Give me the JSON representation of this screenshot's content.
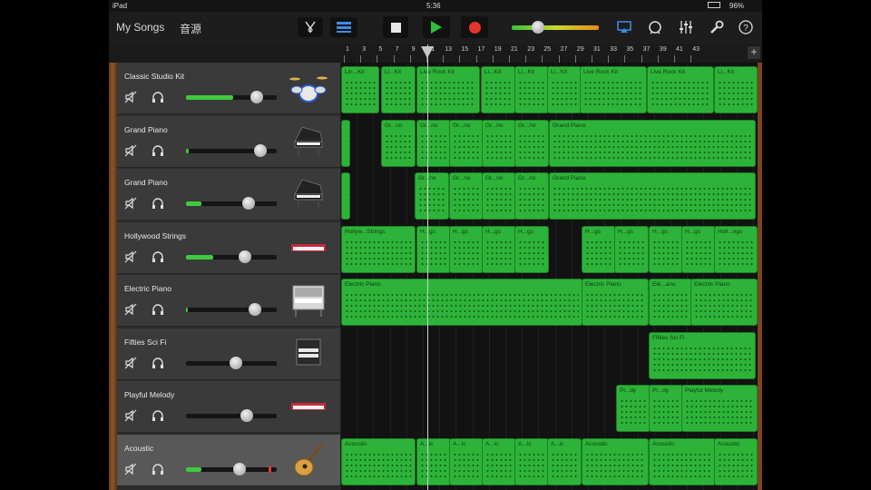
{
  "status_bar": {
    "device": "iPad",
    "time": "5:36",
    "battery": "96%"
  },
  "toolbar": {
    "my_songs": "My Songs",
    "browse": "音源",
    "volume_level": 0.3
  },
  "ruler": {
    "bars": [
      "1",
      "3",
      "5",
      "7",
      "9",
      "11",
      "13",
      "15",
      "17",
      "19",
      "21",
      "23",
      "25",
      "27",
      "29",
      "31",
      "33",
      "35",
      "37",
      "39",
      "41",
      "43"
    ]
  },
  "colors": {
    "region": "#2eb33a",
    "volume": "#3fca3f",
    "record": "#e5342c",
    "play": "#2fbf3a",
    "wood": "#8a5428"
  },
  "tracks": [
    {
      "name": "Classic Studio Kit",
      "instrument": "drum-kit",
      "volume": 0.78,
      "fill": 0.52,
      "regions": [
        {
          "label": "Lin...Kit"
        },
        {
          "label": "Li...Kit"
        },
        {
          "label": "Live Rock Kit"
        },
        {
          "label": "Li...Kit"
        },
        {
          "label": "Li...Kit"
        },
        {
          "label": "Li...Kit"
        },
        {
          "label": "Live Rock Kit"
        },
        {
          "label": "Live Rock Kit"
        },
        {
          "label": "Li...Kit"
        }
      ]
    },
    {
      "name": "Grand Piano",
      "instrument": "grand-piano",
      "volume": 0.82,
      "fill": 0.03,
      "regions": [
        {
          "label": ""
        },
        {
          "label": "Gr...no"
        },
        {
          "label": "Gr...no"
        },
        {
          "label": "Gr...no"
        },
        {
          "label": "Gr...no"
        },
        {
          "label": "Gr...no"
        },
        {
          "label": "Grand Piano"
        }
      ]
    },
    {
      "name": "Grand Piano",
      "instrument": "grand-piano",
      "volume": 0.69,
      "fill": 0.17,
      "regions": [
        {
          "label": ""
        },
        {
          "label": "Gr...no"
        },
        {
          "label": "Gr...no"
        },
        {
          "label": "Gr...no"
        },
        {
          "label": "Gr...no"
        },
        {
          "label": "Grand Piano"
        }
      ]
    },
    {
      "name": "Hollywood Strings",
      "instrument": "synth-keyboard",
      "volume": 0.65,
      "fill": 0.3,
      "regions": [
        {
          "label": "Hollyw...Strings"
        },
        {
          "label": "H...gs"
        },
        {
          "label": "H...gs"
        },
        {
          "label": "H...gs"
        },
        {
          "label": "H...gs"
        },
        {
          "label": "H...gs"
        },
        {
          "label": "H...gs"
        },
        {
          "label": "H...gs"
        },
        {
          "label": "H...gs"
        },
        {
          "label": "Holl...ngs"
        }
      ]
    },
    {
      "name": "Electric Piano",
      "instrument": "electric-piano",
      "volume": 0.76,
      "fill": 0.02,
      "regions": [
        {
          "label": "Electric Piano"
        },
        {
          "label": "Electric Piano"
        },
        {
          "label": "Ele...ano"
        },
        {
          "label": "Electric Piano"
        }
      ]
    },
    {
      "name": "Fifties Sci Fi",
      "instrument": "organ",
      "volume": 0.55,
      "fill": 0,
      "regions": [
        {
          "label": "Fifties Sci Fi"
        }
      ]
    },
    {
      "name": "Playful Melody",
      "instrument": "synth-keyboard",
      "volume": 0.67,
      "fill": 0,
      "regions": [
        {
          "label": "Pl...dy"
        },
        {
          "label": "Pl...dy"
        },
        {
          "label": "Playful Melody"
        }
      ]
    },
    {
      "name": "Acoustic",
      "instrument": "acoustic-guitar",
      "volume": 0.59,
      "fill": 0.17,
      "selected": true,
      "regions": [
        {
          "label": "Acoustic"
        },
        {
          "label": "A...ic"
        },
        {
          "label": "A...ic"
        },
        {
          "label": "A...ic"
        },
        {
          "label": "A...ic"
        },
        {
          "label": "A...ic"
        },
        {
          "label": "Acoustic"
        },
        {
          "label": "Acoustic"
        },
        {
          "label": "Acoustic"
        }
      ]
    }
  ]
}
